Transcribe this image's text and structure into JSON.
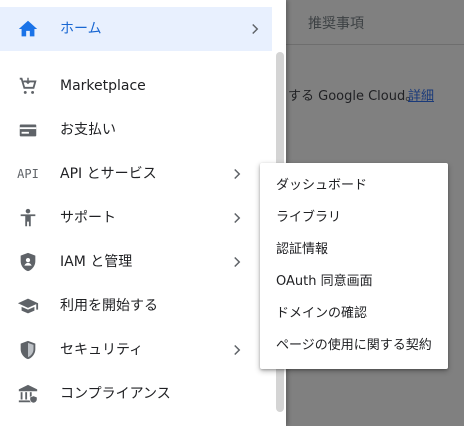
{
  "background": {
    "tab_label": "推奨事項",
    "banner_text": "する Google Cloud。",
    "banner_link": "詳細"
  },
  "nav": {
    "items": [
      {
        "label": "ホーム",
        "icon": "home-icon",
        "active": true,
        "has_submenu": true
      },
      {
        "label": "Marketplace",
        "icon": "cart-icon",
        "has_submenu": false
      },
      {
        "label": "お支払い",
        "icon": "billing-card-icon",
        "has_submenu": false
      },
      {
        "label": "API とサービス",
        "icon": "api-icon",
        "icon_text": "API",
        "has_submenu": true
      },
      {
        "label": "サポート",
        "icon": "support-person-icon",
        "has_submenu": true
      },
      {
        "label": "IAM と管理",
        "icon": "shield-icon",
        "has_submenu": true
      },
      {
        "label": "利用を開始する",
        "icon": "graduation-cap-icon",
        "has_submenu": false
      },
      {
        "label": "セキュリティ",
        "icon": "security-shield-icon",
        "has_submenu": true
      },
      {
        "label": "コンプライアンス",
        "icon": "bank-building-icon",
        "has_submenu": false
      }
    ]
  },
  "flyout": {
    "items": [
      {
        "label": "ダッシュボード"
      },
      {
        "label": "ライブラリ"
      },
      {
        "label": "認証情報"
      },
      {
        "label": "OAuth 同意画面"
      },
      {
        "label": "ドメインの確認"
      },
      {
        "label": "ページの使用に関する契約"
      }
    ]
  },
  "colors": {
    "accent": "#1967d2",
    "active_bg": "#e8f0fe",
    "icon_gray": "#5f6368",
    "overlay": "#808080"
  }
}
